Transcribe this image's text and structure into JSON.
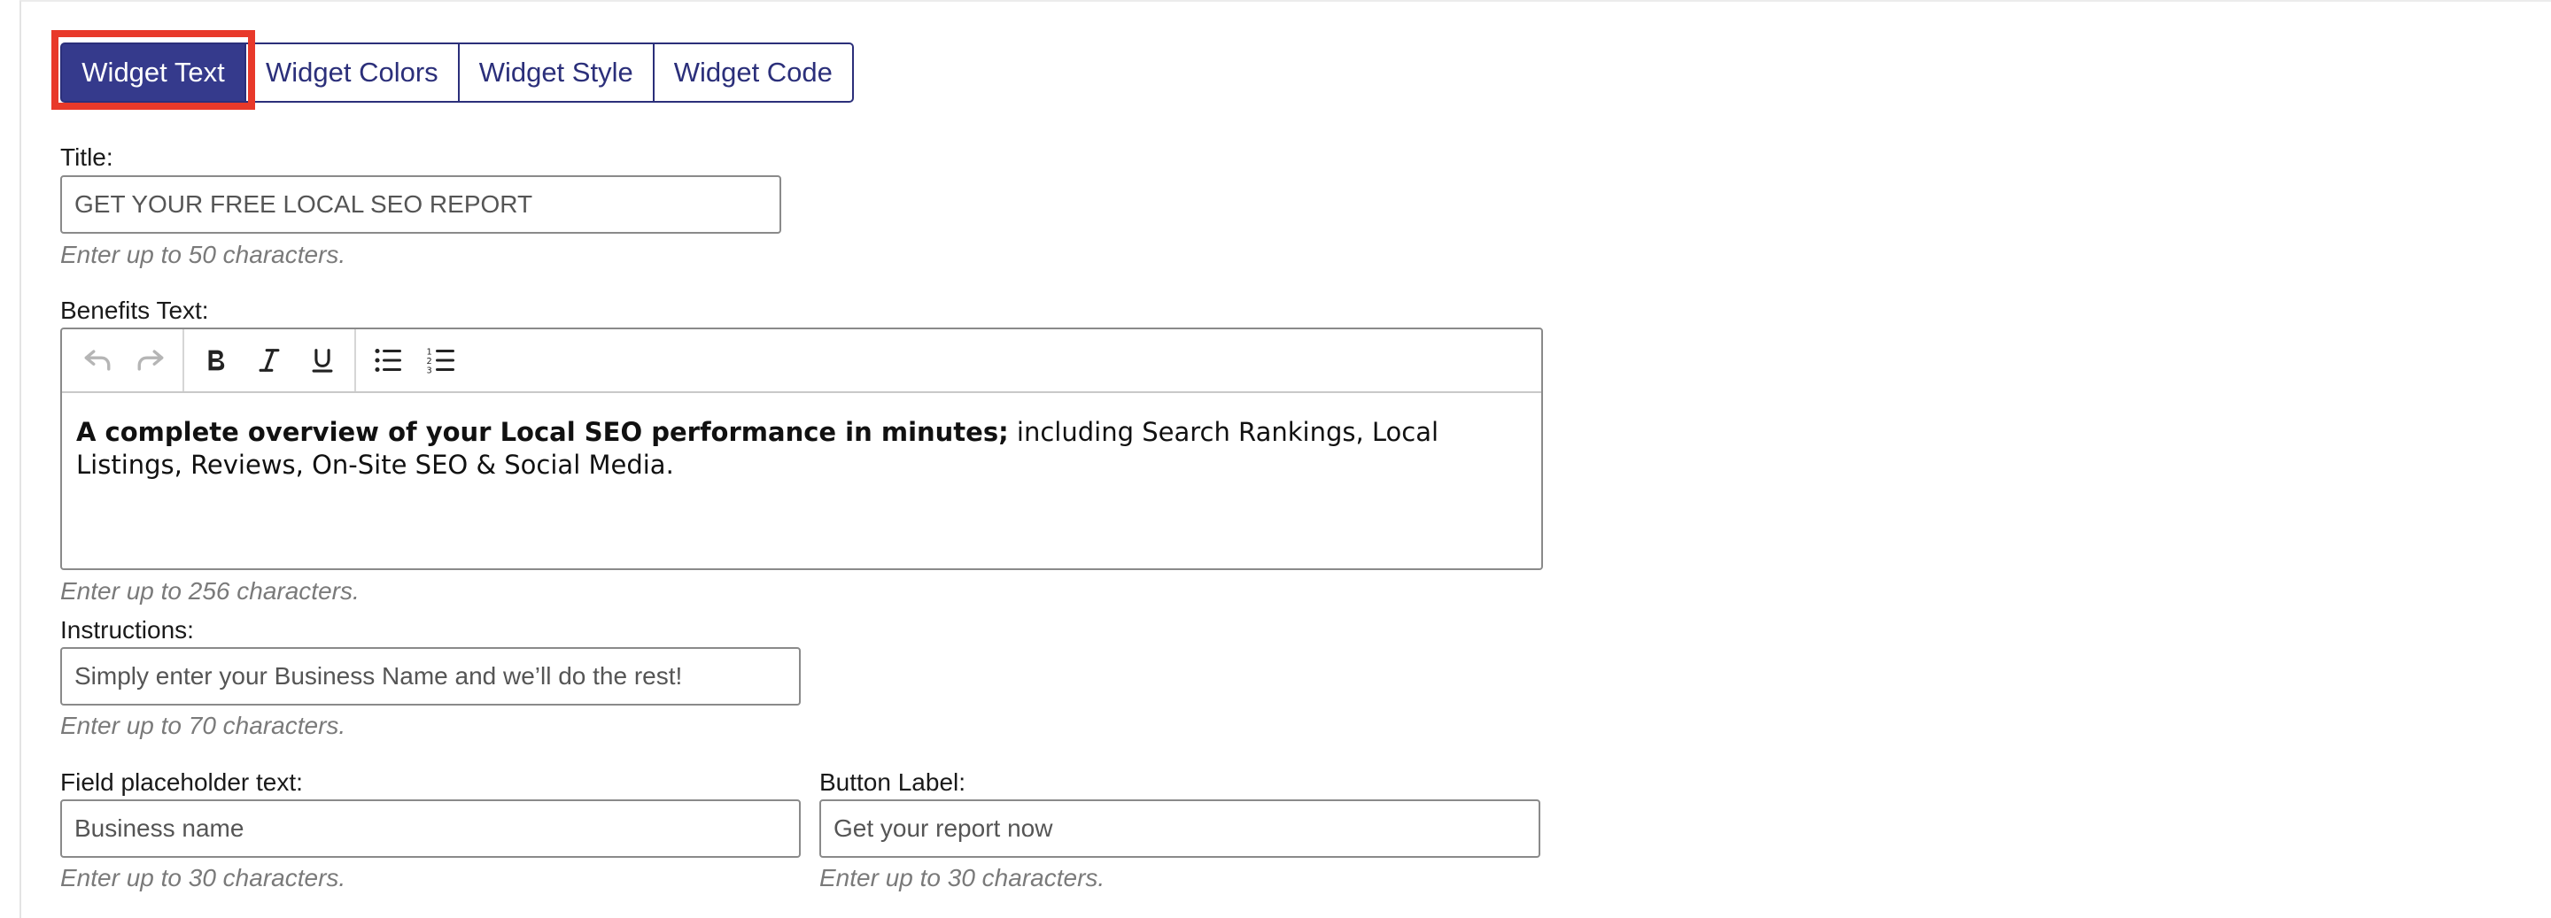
{
  "tabs": [
    {
      "label": "Widget Text",
      "active": true
    },
    {
      "label": "Widget Colors",
      "active": false
    },
    {
      "label": "Widget Style",
      "active": false
    },
    {
      "label": "Widget Code",
      "active": false
    }
  ],
  "colors": {
    "accent": "#353a8c",
    "focus": "#e8392a",
    "hint": "#7a7a7a"
  },
  "title_field": {
    "label": "Title:",
    "value": "GET YOUR FREE LOCAL SEO REPORT",
    "hint": "Enter up to 50 characters."
  },
  "benefits": {
    "label": "Benefits Text:",
    "toolbar_icons": [
      "undo-icon",
      "redo-icon",
      "bold-icon",
      "italic-icon",
      "underline-icon",
      "bullet-list-icon",
      "numbered-list-icon"
    ],
    "bold_text": "A complete overview of your Local SEO performance in minutes;",
    "plain_text": " including Search Rankings, Local Listings, Reviews, On-Site SEO & Social Media.",
    "hint": "Enter up to 256 characters."
  },
  "instructions": {
    "label": "Instructions:",
    "value": "Simply enter your Business Name and we’ll do the rest!",
    "hint": "Enter up to 70 characters."
  },
  "placeholder_field": {
    "label": "Field placeholder text:",
    "value": "Business name",
    "hint": "Enter up to 30 characters."
  },
  "button_label_field": {
    "label": "Button Label:",
    "value": "Get your report now",
    "hint": "Enter up to 30 characters."
  }
}
